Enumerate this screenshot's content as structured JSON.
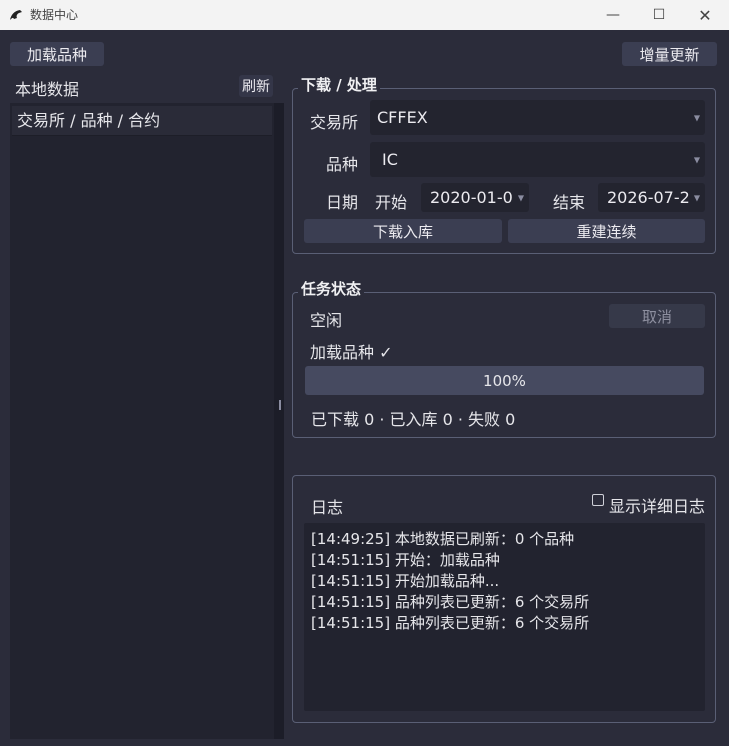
{
  "window": {
    "title": "数据中心"
  },
  "toolbar": {
    "load_button": "加载品种",
    "incremental_button": "增量更新"
  },
  "sidebar": {
    "label": "本地数据",
    "refresh_button": "刷新",
    "tree_header": "交易所 / 品种 / 合约"
  },
  "download": {
    "title": "下载 / 处理",
    "exchange_label": "交易所",
    "exchange_value": "CFFEX",
    "product_label": "品种",
    "product_value": "IC",
    "date_label": "日期",
    "start_label": "开始",
    "start_value": "2020-01-0",
    "end_label": "结束",
    "end_value": "2026-07-2",
    "download_button": "下载入库",
    "rebuild_button": "重建连续"
  },
  "task": {
    "title": "任务状态",
    "state": "空闲",
    "cancel_button": "取消",
    "current_task": "加载品种 ✓",
    "progress_value": 100,
    "progress_text": "100%",
    "stats": "已下载 0 · 已入库 0 · 失败 0"
  },
  "log": {
    "title": "日志",
    "verbose_label": "显示详细日志",
    "verbose_checked": false,
    "lines": [
      "[14:49:25] 本地数据已刷新：0 个品种",
      "[14:51:15] 开始：加载品种",
      "[14:51:15] 开始加载品种...",
      "[14:51:15] 品种列表已更新：6 个交易所",
      "[14:51:15] 品种列表已更新：6 个交易所"
    ]
  },
  "colors": {
    "background": "#2b2c3a",
    "panel": "#22232f",
    "button": "#3b3e52",
    "border": "#5a5f75"
  }
}
